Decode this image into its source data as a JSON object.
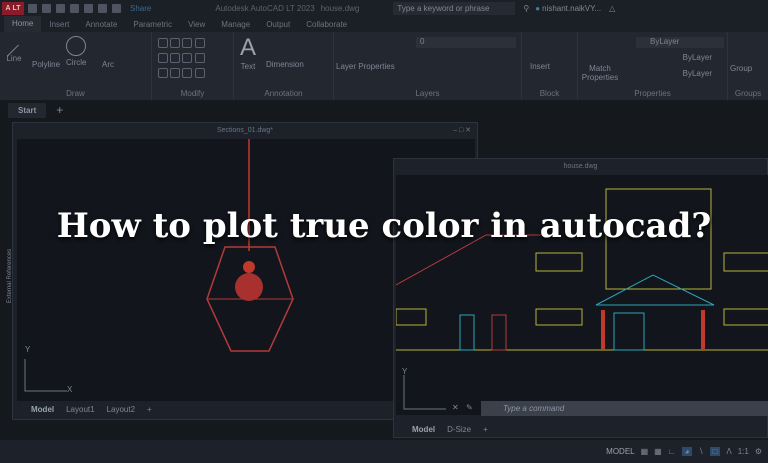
{
  "titlebar": {
    "app_badge": "A",
    "product_badge": "LT",
    "share": "Share",
    "title": "Autodesk AutoCAD LT 2023",
    "file": "house.dwg",
    "search_placeholder": "Type a keyword or phrase",
    "user": "nishant.naikVY..."
  },
  "ribbon_tabs": [
    "Home",
    "Insert",
    "Annotate",
    "Parametric",
    "View",
    "Manage",
    "Output",
    "Collaborate"
  ],
  "panels": {
    "draw": {
      "title": "Draw",
      "tools": [
        "Line",
        "Polyline",
        "Circle",
        "Arc"
      ]
    },
    "modify": {
      "title": "Modify"
    },
    "annotation": {
      "title": "Annotation",
      "tools": [
        "Text",
        "Dimension"
      ]
    },
    "layers": {
      "title": "Layers",
      "tool": "Layer Properties",
      "current_layer": "0"
    },
    "block": {
      "title": "Block",
      "tool": "Insert"
    },
    "properties": {
      "title": "Properties",
      "tool": "Match Properties",
      "color": "ByLayer",
      "linetype": "ByLayer",
      "lineweight": "ByLayer"
    },
    "groups": {
      "title": "Groups",
      "tool": "Group"
    }
  },
  "doc_tabs": {
    "start": "Start",
    "add": "+"
  },
  "window1": {
    "title": "Sections_01.dwg*",
    "side_label": "External References",
    "layouts": [
      "Model",
      "Layout1",
      "Layout2"
    ],
    "add": "+",
    "axis_y": "Y",
    "axis_x": "X"
  },
  "window2": {
    "title": "house.dwg",
    "layouts": [
      "Model",
      "D-Size"
    ],
    "add": "+",
    "axis_y": "Y"
  },
  "command": {
    "placeholder": "Type a command"
  },
  "status": {
    "model": "MODEL",
    "scale": "1:1"
  },
  "headline": "How to plot true color in autocad?",
  "colors": {
    "background": "#15181d",
    "ribbon": "#222730",
    "brand": "#8a1b28",
    "drawing_red": "#c0392b",
    "drawing_yellow": "#b8b23a",
    "drawing_cyan": "#2aa6b8"
  }
}
